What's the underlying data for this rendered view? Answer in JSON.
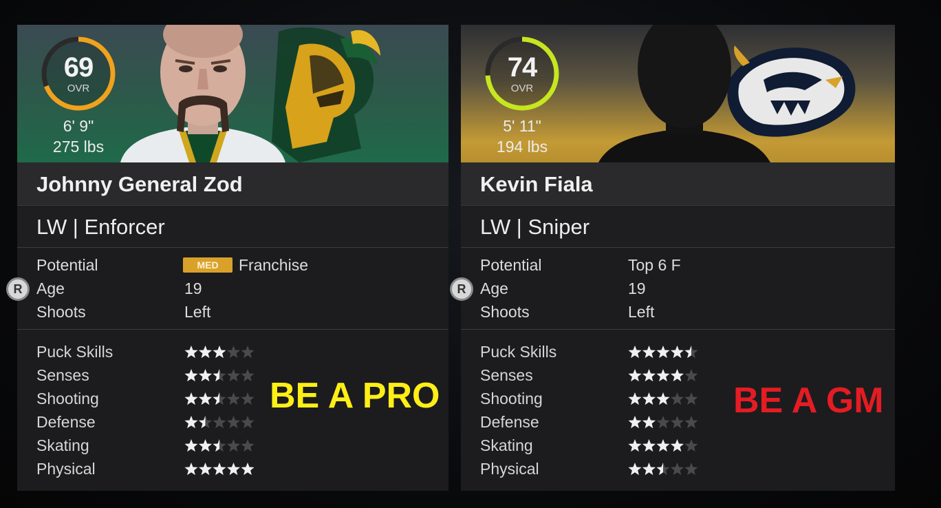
{
  "ui": {
    "ring_track": "#2a2a2a",
    "star_on": "#f0f0f0",
    "star_off": "#4a4a4c",
    "controller_button": "R"
  },
  "cards": [
    {
      "ovr": "69",
      "ovr_label": "OVR",
      "ovr_ring_fill": 0.69,
      "ring_color": "#f0a21e",
      "height": "6' 9\"",
      "weight": "275 lbs",
      "name": "Johnny General Zod",
      "position_line": "LW | Enforcer",
      "potential_label": "Potential",
      "potential_badge": "MED",
      "potential_value": "Franchise",
      "age_label": "Age",
      "age": "19",
      "shoots_label": "Shoots",
      "shoots": "Left",
      "mode": "BE A PRO",
      "mode_color": "#ffef16",
      "hero_icons": [
        "player-portrait",
        "team-logo-knight"
      ],
      "skills": [
        {
          "label": "Puck Skills",
          "stars": 3
        },
        {
          "label": "Senses",
          "stars": 2.5
        },
        {
          "label": "Shooting",
          "stars": 2.5
        },
        {
          "label": "Defense",
          "stars": 1.5
        },
        {
          "label": "Skating",
          "stars": 2.5
        },
        {
          "label": "Physical",
          "stars": 5
        }
      ]
    },
    {
      "ovr": "74",
      "ovr_label": "OVR",
      "ovr_ring_fill": 0.74,
      "ring_color": "#c6e620",
      "height": "5' 11\"",
      "weight": "194 lbs",
      "name": "Kevin Fiala",
      "position_line": "LW | Sniper",
      "potential_label": "Potential",
      "potential_value": "Top 6 F",
      "age_label": "Age",
      "age": "19",
      "shoots_label": "Shoots",
      "shoots": "Left",
      "mode": "BE A GM",
      "mode_color": "#e41c23",
      "hero_icons": [
        "player-silhouette",
        "team-logo-predator"
      ],
      "skills": [
        {
          "label": "Puck Skills",
          "stars": 4.5
        },
        {
          "label": "Senses",
          "stars": 4
        },
        {
          "label": "Shooting",
          "stars": 3
        },
        {
          "label": "Defense",
          "stars": 2
        },
        {
          "label": "Skating",
          "stars": 4
        },
        {
          "label": "Physical",
          "stars": 2.5
        }
      ]
    }
  ]
}
